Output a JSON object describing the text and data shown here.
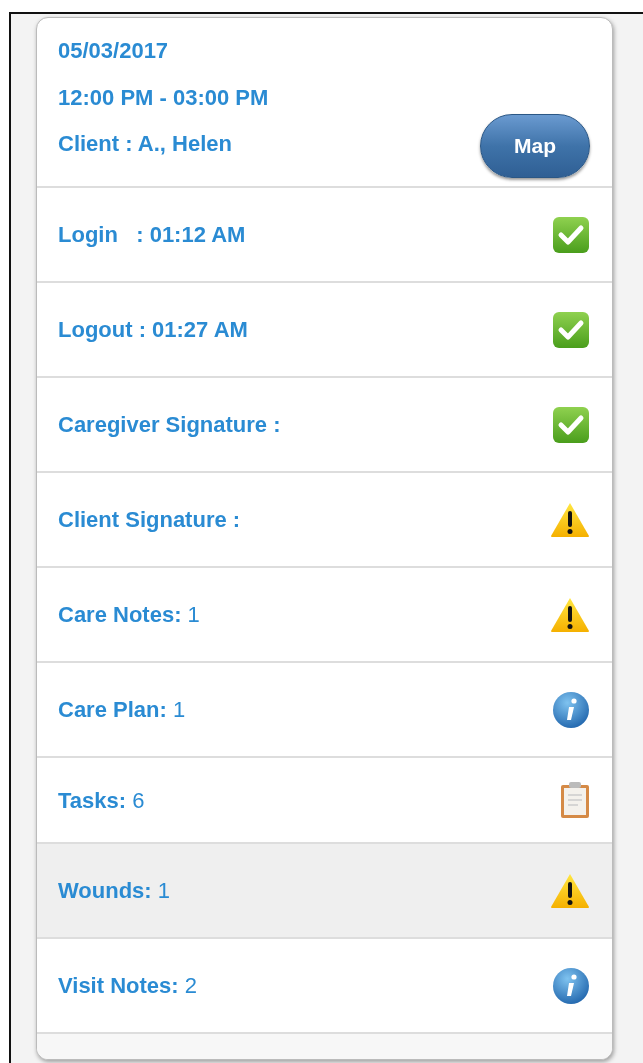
{
  "visit": {
    "date": "05/03/2017",
    "time": "12:00 PM - 03:00 PM",
    "client": "Client : A., Helen",
    "map_button": "Map"
  },
  "rows": [
    {
      "label": "Login   : 01:12 AM",
      "kind": "done",
      "selected": false
    },
    {
      "label": "Logout : 01:27 AM",
      "kind": "done",
      "selected": false
    },
    {
      "label": "Caregiver Signature :",
      "kind": "done",
      "selected": false
    },
    {
      "label": "Client Signature :",
      "kind": "warning",
      "selected": false
    },
    {
      "label": "Care Notes:",
      "count": "1",
      "kind": "warning",
      "selected": false
    },
    {
      "label": "Care Plan:",
      "count": "1",
      "kind": "info",
      "selected": false
    },
    {
      "label": "Tasks:",
      "count": "6",
      "kind": "task",
      "selected": false
    },
    {
      "label": "Wounds:",
      "count": "1",
      "kind": "warning",
      "selected": true
    },
    {
      "label": "Visit Notes:",
      "count": "2",
      "kind": "info",
      "selected": false
    }
  ]
}
